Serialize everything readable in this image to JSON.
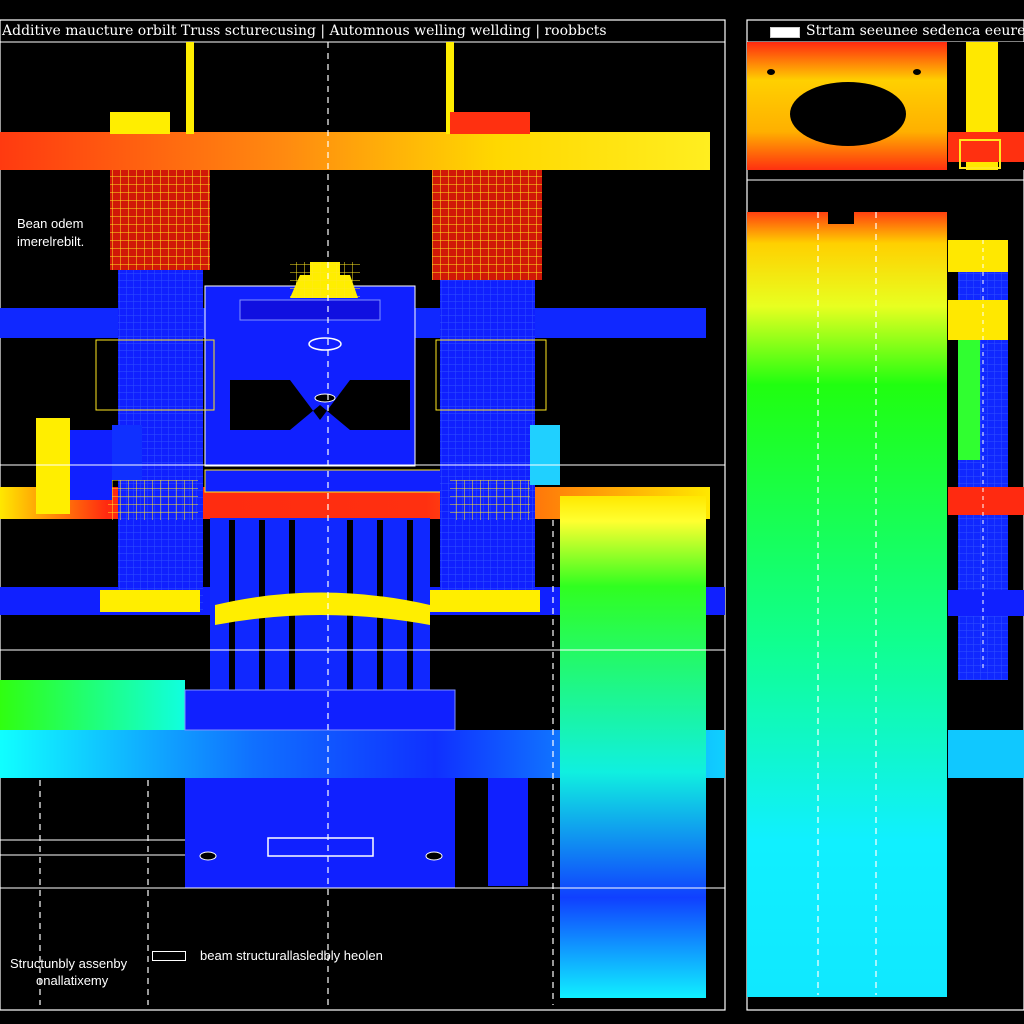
{
  "main_panel": {
    "title": "Additive maucture orbilt Truss scturecusing | Automnous welling wellding | roobbcts",
    "callout": [
      "Bean odem",
      "imerelrebilt."
    ],
    "footnote": [
      "Structunbly assenby",
      "onallatixemy"
    ],
    "legend_label": "beam structurallasledbly heolen"
  },
  "side_panel": {
    "title": "Strtam seeunee sedenca eeure"
  },
  "colors": {
    "background": "#000000",
    "structure_blue": "#1020ff",
    "hot_red": "#ff2a10",
    "warm_yellow": "#ffee00",
    "green": "#20ff20",
    "cyan": "#10f0ff",
    "outline": "#ffffff"
  }
}
